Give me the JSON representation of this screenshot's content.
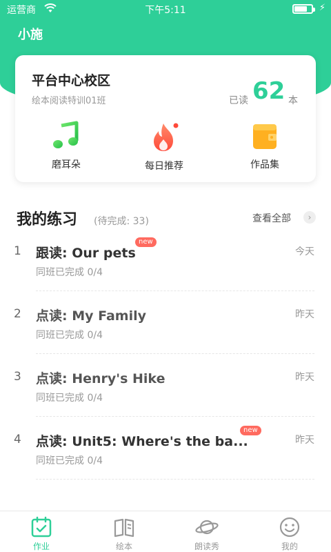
{
  "status_bar": {
    "carrier": "运营商",
    "time": "下午5:11",
    "battery_level": 0.75
  },
  "app": {
    "title": "小施"
  },
  "school_card": {
    "school": "平台中心校区",
    "class_name": "绘本阅读特训01班",
    "read_label": "已读",
    "read_count": "62",
    "read_unit": "本",
    "features": [
      {
        "label": "磨耳朵",
        "icon": "music-note-icon"
      },
      {
        "label": "每日推荐",
        "icon": "flame-icon"
      },
      {
        "label": "作品集",
        "icon": "wallet-icon"
      }
    ]
  },
  "practice": {
    "title": "我的练习",
    "subtitle": "(待完成: 33)",
    "view_all": "查看全部",
    "items": [
      {
        "index": "1",
        "title": "跟读: Our pets",
        "badge": "new",
        "date": "今天",
        "progress": "同班已完成 0/4"
      },
      {
        "index": "2",
        "title": "点读: My Family",
        "badge": "",
        "date": "昨天",
        "progress": "同班已完成 0/4"
      },
      {
        "index": "3",
        "title": "点读: Henry's Hike",
        "badge": "",
        "date": "昨天",
        "progress": "同班已完成 0/4"
      },
      {
        "index": "4",
        "title": "点读: Unit5: Where's the ba...",
        "badge": "new",
        "date": "昨天",
        "progress": "同班已完成 0/4"
      }
    ]
  },
  "tabs": [
    {
      "label": "作业",
      "icon": "calendar-check-icon",
      "active": true
    },
    {
      "label": "绘本",
      "icon": "book-icon",
      "active": false
    },
    {
      "label": "朗读秀",
      "icon": "planet-icon",
      "active": false
    },
    {
      "label": "我的",
      "icon": "smiley-icon",
      "active": false
    }
  ],
  "colors": {
    "accent": "#2ecf98",
    "badge": "#ff6a5f",
    "flame": "#ff5a4a",
    "wallet": "#ffb020"
  }
}
